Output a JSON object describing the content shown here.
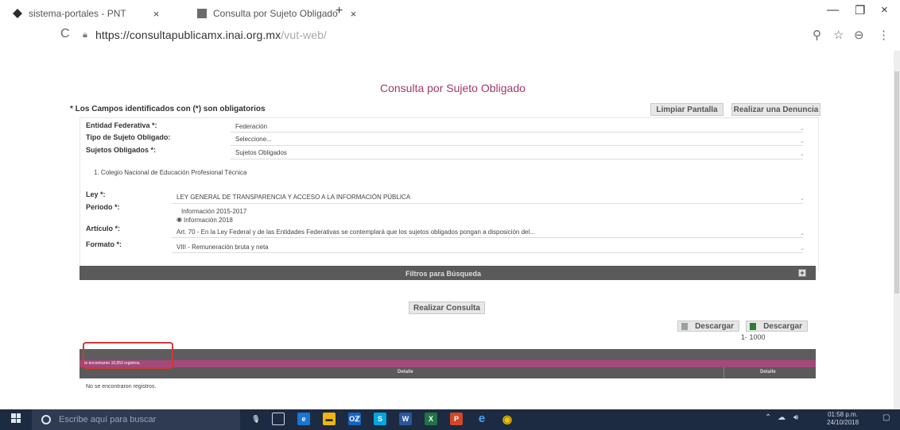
{
  "tabs": [
    {
      "label": "sistema-portales - PNT",
      "close": "×"
    },
    {
      "label": "Consulta por Sujeto Obligado",
      "close": "×"
    }
  ],
  "newtab": "+",
  "window": {
    "minimize": "—",
    "maximize": "❐",
    "close": "×"
  },
  "address": {
    "reload": "C",
    "host": "https://consultapublicamx.inai.org.mx",
    "path": "/vut-web/"
  },
  "toolbar_icons": {
    "zoom": "⚲",
    "bookmark": "☆",
    "profile": "⊖",
    "menu": "⋮"
  },
  "page": {
    "heading": "Consulta por Sujeto Obligado",
    "required_note": "* Los Campos identificados con (*) son obligatorios",
    "clear_button": "Limpiar Pantalla",
    "report_button": "Realizar una Denuncia",
    "fields": {
      "entidad_label": "Entidad Federativa *:",
      "entidad_value": "Federación",
      "tipo_label": "Tipo de Sujeto Obligado:",
      "tipo_value": "Seleccione...",
      "sujetos_label": "Sujetos Obligados *:",
      "sujetos_value": "Sujetos Obligados",
      "selected_subject": "1. Colegio Nacional de Educación Profesional Técnica",
      "ley_label": "Ley *:",
      "ley_value": "LEY GENERAL DE TRANSPARENCIA Y ACCESO A LA INFORMACIÓN PÚBLICA",
      "periodo_label": "Periodo *:",
      "periodo_opt1": "Información 2015-2017",
      "periodo_opt2": "Información 2018",
      "articulo_label": "Artículo *:",
      "articulo_value": "Art. 70 - En la Ley Federal y de las Entidades Federativas se contemplará que los sujetos obligados pongan a disposición del...",
      "formato_label": "Formato *:",
      "formato_value": "VIII - Remuneración bruta y neta"
    },
    "filters_bar": "Filtros para Búsqueda",
    "filters_toggle": "+",
    "query_button": "Realizar Consulta",
    "download1": "Descargar",
    "download2": "Descargar",
    "page_selector": "1- 1000",
    "records_found": "Se encontraron 10,053 registros.",
    "col_detalle_1": "Detalle",
    "col_detalle_2": "Detalle",
    "no_records": "No se encontraron registros."
  },
  "taskbar": {
    "search_placeholder": "Escribe aquí para buscar",
    "time": "01:58 p.m.",
    "date": "24/10/2018",
    "apps": [
      "e",
      "▬",
      "Oℤ",
      "S",
      "W",
      "X",
      "P",
      "e",
      "◉"
    ]
  }
}
